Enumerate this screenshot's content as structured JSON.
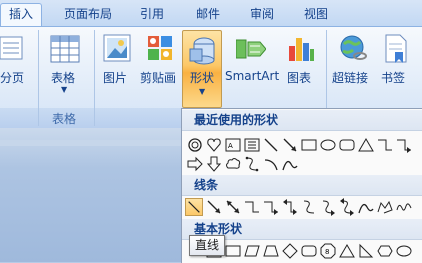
{
  "tabs": [
    {
      "label": "插入",
      "active": true
    },
    {
      "label": "页面布局"
    },
    {
      "label": "引用"
    },
    {
      "label": "邮件"
    },
    {
      "label": "审阅"
    },
    {
      "label": "视图"
    }
  ],
  "ribbon": {
    "partial_left_label": "分页",
    "table_button": "表格",
    "table_group": "表格",
    "picture": "图片",
    "clipart": "剪贴画",
    "shapes": "形状",
    "smartart": "SmartArt",
    "chart": "图表",
    "hyperlink": "超链接",
    "bookmark": "书签"
  },
  "shapes_menu": {
    "recent_header": "最近使用的形状",
    "lines_header": "线条",
    "basic_header": "基本形状",
    "tooltip": "直线"
  },
  "colors": {
    "accent_text": "#15428b",
    "pressed_fill": "#fcc868"
  }
}
